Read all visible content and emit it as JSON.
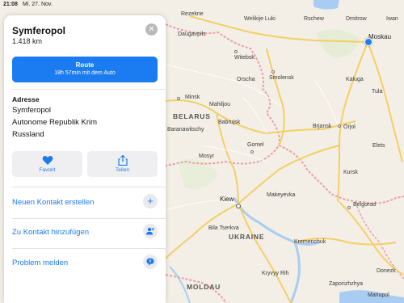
{
  "status_bar": {
    "time": "21:08",
    "date": "Mi. 27. Nov."
  },
  "place": {
    "title": "Symferopol",
    "distance": "1.418 km",
    "route": {
      "label": "Route",
      "duration": "18h 57min mit dem Auto"
    },
    "address_label": "Adresse",
    "address_lines": [
      "Symferopol",
      "Autonome Republik Krim",
      "Russland"
    ],
    "actions": [
      {
        "label": "Favorit",
        "icon": "heart-icon"
      },
      {
        "label": "Teilen",
        "icon": "share-icon"
      }
    ],
    "rows": [
      {
        "label": "Neuen Kontakt erstellen",
        "icon": "plus-icon"
      },
      {
        "label": "Zu Kontakt hinzufügen",
        "icon": "add-contact-icon"
      },
      {
        "label": "Problem melden",
        "icon": "report-problem-icon"
      }
    ]
  },
  "map": {
    "countries": [
      "BELARUS",
      "UKRAINE",
      "MOLDAU"
    ],
    "cities": [
      "Rezekne",
      "Welikije Luki",
      "Rschew",
      "Dmitrow",
      "Iwan",
      "Daugavpils",
      "Moskau",
      "Witebsk",
      "Smolensk",
      "Orscha",
      "Kaluga",
      "Tula",
      "Minsk",
      "Mahiljou",
      "Babrujsk",
      "Brjansk",
      "Orjol",
      "Baranawitschy",
      "Elets",
      "Mosyr",
      "Gomel",
      "Kursk",
      "Kiew",
      "Makeyevka",
      "Belgorod",
      "Bila Tserkva",
      "Kremenchuk",
      "Kryvyy Rih",
      "Zaporizhzhya",
      "Donezk",
      "Mariupol"
    ]
  },
  "colors": {
    "accent": "#1b7bf0",
    "map_background": "#f3efe6",
    "border": "#e7a0a6",
    "road": "#f3cf66",
    "water": "#a9cdf2"
  }
}
